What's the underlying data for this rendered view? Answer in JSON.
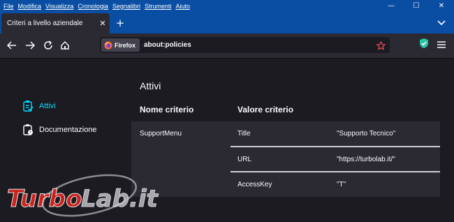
{
  "menubar": {
    "items": [
      "File",
      "Modifica",
      "Visualizza",
      "Cronologia",
      "Segnalibri",
      "Strumenti",
      "Aiuto"
    ]
  },
  "window_controls": {
    "minimize": "—",
    "maximize": "☐",
    "close": "✕"
  },
  "tab": {
    "title": "Criteri a livello aziendale",
    "close": "✕",
    "new_tab": "+"
  },
  "urlbar": {
    "identity_label": "Firefox",
    "url": "about:policies"
  },
  "sidebar": {
    "items": [
      {
        "label": "Attivi",
        "active": true
      },
      {
        "label": "Documentazione",
        "active": false
      }
    ]
  },
  "main": {
    "heading": "Attivi",
    "columns": [
      "Nome criterio",
      "Valore criterio"
    ],
    "policies": [
      {
        "name": "SupportMenu",
        "values": [
          {
            "key": "Title",
            "value": "\"Supporto Tecnico\""
          },
          {
            "key": "URL",
            "value": "\"https://turbolab.it/\""
          },
          {
            "key": "AccessKey",
            "value": "\"T\""
          }
        ]
      }
    ]
  },
  "colors": {
    "title_bar": "#0a4ea3",
    "toolbar": "#2b2a33",
    "page_bg": "#1c1b22",
    "accent": "#00ddff",
    "url_text": "#fbfbfe"
  },
  "watermark": "TurboLab.it"
}
